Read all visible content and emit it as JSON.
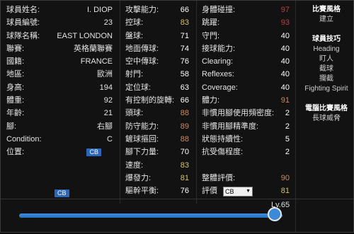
{
  "info": [
    {
      "label": "球員姓名:",
      "value": "I. DIOP"
    },
    {
      "label": "球員編號:",
      "value": "23"
    },
    {
      "label": "球隊名稱:",
      "value": "EAST LONDON"
    },
    {
      "label": "聯賽:",
      "value": "英格蘭聯賽"
    },
    {
      "label": "國籍:",
      "value": "FRANCE"
    },
    {
      "label": "地區:",
      "value": "歐洲"
    },
    {
      "label": "身高:",
      "value": "194"
    },
    {
      "label": "體重:",
      "value": "92"
    },
    {
      "label": "年齡:",
      "value": "21"
    },
    {
      "label": "腳:",
      "value": "右腳"
    },
    {
      "label": "Condition:",
      "value": "C"
    },
    {
      "label": "位置:",
      "value": "CB"
    }
  ],
  "bottom_badge": "CB",
  "stats_mid": [
    {
      "label": "攻擊能力:",
      "value": "66",
      "color": "white"
    },
    {
      "label": "控球:",
      "value": "83",
      "color": "yellow"
    },
    {
      "label": "盤球:",
      "value": "71",
      "color": "white"
    },
    {
      "label": "地面傳球:",
      "value": "74",
      "color": "white"
    },
    {
      "label": "空中傳球:",
      "value": "76",
      "color": "white"
    },
    {
      "label": "射門:",
      "value": "58",
      "color": "white"
    },
    {
      "label": "定位球:",
      "value": "63",
      "color": "white"
    },
    {
      "label": "有控制的旋轉:",
      "value": "66",
      "color": "white"
    },
    {
      "label": "頭球:",
      "value": "88",
      "color": "orange"
    },
    {
      "label": "防守能力:",
      "value": "89",
      "color": "orange"
    },
    {
      "label": "鏟球摳回:",
      "value": "88",
      "color": "orange"
    },
    {
      "label": "腳下力量:",
      "value": "70",
      "color": "white"
    },
    {
      "label": "速度:",
      "value": "83",
      "color": "yellow"
    },
    {
      "label": "爆發力:",
      "value": "81",
      "color": "yellow"
    },
    {
      "label": "驅幹平衡:",
      "value": "76",
      "color": "white"
    }
  ],
  "stats_right": [
    {
      "label": "身體碰撞:",
      "value": "97",
      "color": "red"
    },
    {
      "label": "跳躍:",
      "value": "93",
      "color": "red"
    },
    {
      "label": "守門:",
      "value": "40",
      "color": "white"
    },
    {
      "label": "接球能力:",
      "value": "40",
      "color": "white"
    },
    {
      "label": "Clearing:",
      "value": "40",
      "color": "white"
    },
    {
      "label": "Reflexes:",
      "value": "40",
      "color": "white"
    },
    {
      "label": "Coverage:",
      "value": "40",
      "color": "white"
    },
    {
      "label": "體力:",
      "value": "91",
      "color": "orange"
    },
    {
      "label": "非慣用腳使用頻密度:",
      "value": "2",
      "color": "white"
    },
    {
      "label": "非慣用腳精準度:",
      "value": "2",
      "color": "white"
    },
    {
      "label": "狀態持續性:",
      "value": "5",
      "color": "white"
    },
    {
      "label": "抗受傷程度:",
      "value": "2",
      "color": "white"
    },
    {
      "label": "",
      "value": "",
      "color": "white"
    },
    {
      "label": "整體評價:",
      "value": "90",
      "color": "orange"
    },
    {
      "label": "評價",
      "value": "81",
      "color": "yellow",
      "select": "CB"
    }
  ],
  "side": {
    "style_title": "比賽風格",
    "style_value": "建立",
    "skills_title": "球員技巧",
    "skills": [
      "Heading",
      "盯人",
      "截球",
      "攔截",
      "Fighting Spirit"
    ],
    "ai_title": "電腦比賽風格",
    "ai_value": "長球威脅"
  },
  "slider": {
    "level_label": "Lv.65",
    "fraction": 0.97
  }
}
